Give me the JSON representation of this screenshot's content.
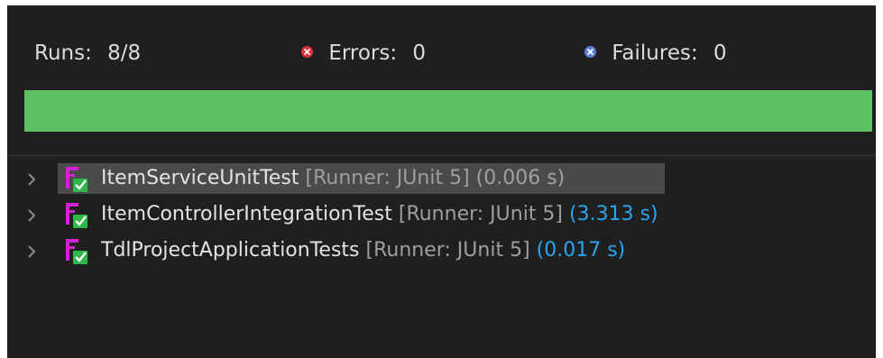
{
  "summary": {
    "runs_label": "Runs:",
    "runs_value": "8/8",
    "errors_label": "Errors:",
    "errors_value": "0",
    "failures_label": "Failures:",
    "failures_value": "0",
    "errors_icon": "error-x-icon",
    "failures_icon": "failure-x-icon"
  },
  "progress": {
    "fraction": 1.0,
    "color": "#5fbf63"
  },
  "tree": {
    "rows": [
      {
        "name": "ItemServiceUnitTest",
        "runner": "[Runner: JUnit 5]",
        "time": "(0.006 s)",
        "selected": true
      },
      {
        "name": "ItemControllerIntegrationTest",
        "runner": "[Runner: JUnit 5]",
        "time": "(3.313 s)",
        "selected": false
      },
      {
        "name": "TdlProjectApplicationTests",
        "runner": "[Runner: JUnit 5]",
        "time": "(0.017 s)",
        "selected": false
      }
    ]
  },
  "colors": {
    "background": "#1f1f1f",
    "error": "#e0303a",
    "failure": "#5a7fd6",
    "success": "#5fbf63",
    "time_highlight": "#2aa4f0",
    "test_icon_magenta": "#d61fd6",
    "test_icon_check": "#2fb84a"
  }
}
